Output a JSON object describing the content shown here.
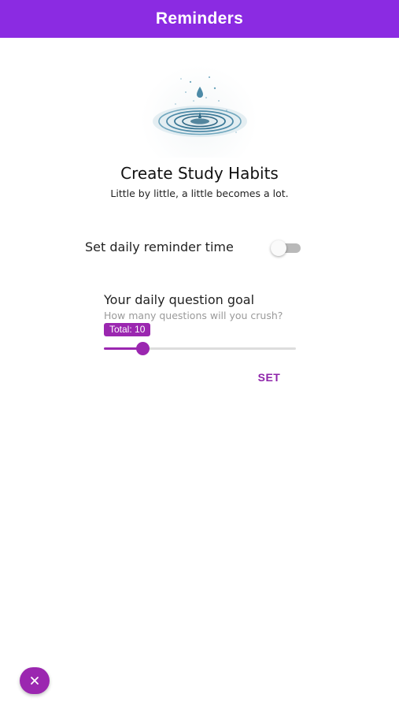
{
  "app_bar": {
    "title": "Reminders"
  },
  "hero": {
    "image_icon": "water-drop-ripple-icon",
    "headline": "Create Study Habits",
    "subline": "Little by little, a little becomes a lot."
  },
  "reminder": {
    "label": "Set daily reminder time",
    "enabled": false
  },
  "goal": {
    "title": "Your daily question goal",
    "subtitle": "How many questions will you crush?",
    "badge_text": "Total: 10",
    "value": 10,
    "slider_fraction": 0.2,
    "set_label": "SET"
  },
  "fab": {
    "icon": "close-icon"
  },
  "colors": {
    "app_bar": "#8b2be2",
    "accent": "#9b27b0",
    "toggle_off_track": "#b9b9b9"
  }
}
